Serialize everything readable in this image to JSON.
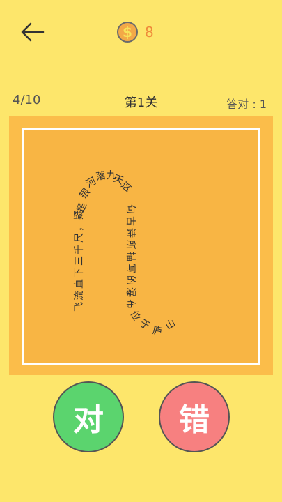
{
  "header": {
    "back_icon": "arrow-left-icon",
    "coin_icon": "dollar-coin-icon",
    "coin_symbol": "$",
    "coin_count": "8"
  },
  "status": {
    "progress": "4/10",
    "level_title": "第1关",
    "correct_label": "答对 : 1"
  },
  "puzzle": {
    "text": "飞流直下三千尺，疑是银河落九天这句古诗所描写的瀑布位于庐山"
  },
  "buttons": {
    "right_label": "对",
    "wrong_label": "错"
  },
  "colors": {
    "background": "#fde66b",
    "board": "#fbbd4a",
    "right": "#5bd46e",
    "wrong": "#f78080",
    "coin": "#f3a947"
  }
}
